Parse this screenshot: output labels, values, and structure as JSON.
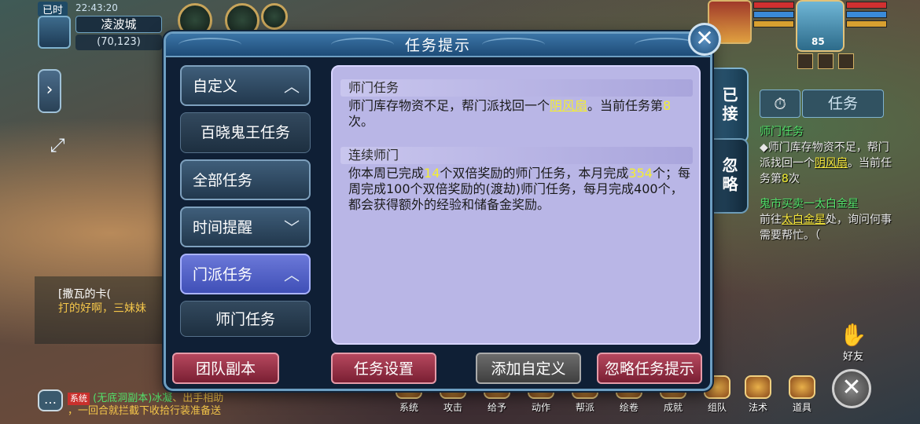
{
  "hud": {
    "time_label": "已时",
    "clock": "22:43:20",
    "location": "凌波城",
    "coords": "(70,123)",
    "player_level": "85"
  },
  "dialog": {
    "title": "任务提示",
    "close_glyph": "✕",
    "categories": [
      {
        "label": "自定义",
        "chevron": "^"
      },
      {
        "label": "百晓鬼王任务"
      },
      {
        "label": "全部任务"
      },
      {
        "label": "时间提醒",
        "chevron": "v"
      },
      {
        "label": "门派任务",
        "chevron": "^"
      },
      {
        "label": "师门任务"
      }
    ],
    "sections": [
      {
        "heading": "师门任务",
        "text_a": "师门库存物资不足，帮门派找回一个",
        "item": "阴风扇",
        "text_b": "。当前任务第",
        "count": "8",
        "text_c": "次。"
      },
      {
        "heading": "连续师门",
        "text_a": "你本周已完成",
        "week_count": "14",
        "text_b": "个双倍奖励的师门任务，本月完成",
        "month_count": "354",
        "text_c": "个；每周完成100个双倍奖励的(渡劫)师门任务，每月完成400个，都会获得额外的经验和储备金奖励。"
      }
    ],
    "footer_buttons": {
      "team_dungeon": "团队副本",
      "quest_settings": "任务设置",
      "add_custom": "添加自定义",
      "ignore_tips": "忽略任务提示"
    }
  },
  "tracker": {
    "tab_accepted": "已接",
    "tab_ignored": "忽略",
    "timer_glyph": "⏱",
    "quest_button": "任务",
    "quest1_title": "师门任务",
    "quest1_a": "◆师门库存物资不足，帮门派找回一个",
    "quest1_item": "阴风扇",
    "quest1_b": "。当前任务第",
    "quest1_count": "8",
    "quest1_c": "次",
    "quest2_title": "鬼市买卖一太白金星",
    "quest2_a": "前往",
    "quest2_npc": "太白金星",
    "quest2_b": "处，询问何事需要帮忙。（"
  },
  "chat": {
    "line1": "[撒瓦的卡(",
    "line2": "打的好啊，三妹妹",
    "bottom_badge": "系统",
    "bottom_channel": "(无底洞副本)冰凝",
    "bottom_msg": "、出手相助",
    "bottom_line2": "，一回合就拦截下收拾行装准备送"
  },
  "menu": {
    "items": [
      "系统",
      "攻击",
      "给予",
      "动作",
      "帮派",
      "绘卷",
      "成就",
      "组队",
      "法术",
      "道具"
    ],
    "friend": "好友",
    "close_glyph": "✕"
  },
  "colors": {
    "dialog_bg": "#0f1f35",
    "content_bg": "#b9b6e6",
    "selected_category": "#5b68cc",
    "highlight_yellow": "#f4ee32",
    "red_button": "#9a3048",
    "gray_button": "#5a5a5a"
  }
}
